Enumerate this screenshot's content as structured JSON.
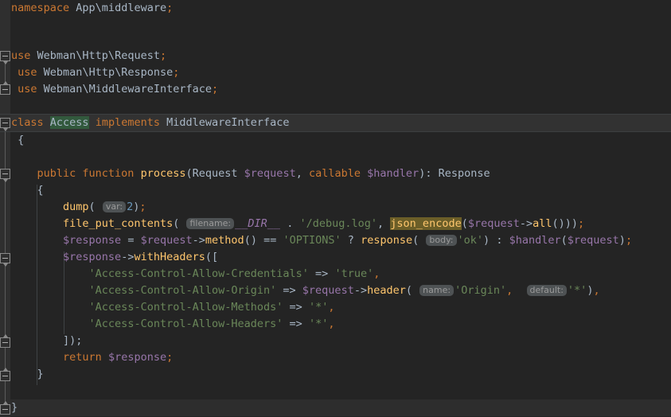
{
  "app": {
    "kind": "code-editor",
    "language": "PHP",
    "theme": "Darcula"
  },
  "colors": {
    "editor_background": "#242424",
    "gutter_background": "#2f2f2f",
    "current_line_highlight": "#323232",
    "keyword": "#cc7832",
    "function": "#ffc66d",
    "variable": "#9876aa",
    "string": "#6a8759",
    "number": "#6897bb",
    "default_text": "#a9b7c6",
    "occurrence_highlight": "#32593d",
    "search_match_highlight": "#6b5e28",
    "inline_hint_background": "#4e5254",
    "inline_hint_text": "#9a9a9a"
  },
  "editor": {
    "lines": [
      {
        "n": 1,
        "indent": 0,
        "text": "namespace App\\middleware;"
      },
      {
        "n": 2,
        "indent": 0,
        "text": ""
      },
      {
        "n": 3,
        "indent": 0,
        "text": ""
      },
      {
        "n": 4,
        "indent": 0,
        "text": ""
      },
      {
        "n": 5,
        "indent": 0,
        "text": "use Webman\\Http\\Request;"
      },
      {
        "n": 6,
        "indent": 0,
        "text": "use Webman\\Http\\Response;"
      },
      {
        "n": 7,
        "indent": 0,
        "text": "use Webman\\MiddlewareInterface;"
      },
      {
        "n": 8,
        "indent": 0,
        "text": ""
      },
      {
        "n": 9,
        "indent": 0,
        "text": ""
      },
      {
        "n": 10,
        "indent": 0,
        "text": "class Access implements MiddlewareInterface"
      },
      {
        "n": 11,
        "indent": 0,
        "text": "{"
      },
      {
        "n": 12,
        "indent": 0,
        "text": ""
      },
      {
        "n": 13,
        "indent": 1,
        "text": "public function process(Request $request, callable $handler): Response"
      },
      {
        "n": 14,
        "indent": 1,
        "text": "{"
      },
      {
        "n": 15,
        "indent": 2,
        "text": "dump( var: 2);"
      },
      {
        "n": 16,
        "indent": 2,
        "text": "file_put_contents( filename: __DIR__ . '/debug.log', json_encode($request->all()));"
      },
      {
        "n": 17,
        "indent": 2,
        "text": "$response = $request->method() == 'OPTIONS' ? response( body: 'ok') : $handler($request);"
      },
      {
        "n": 18,
        "indent": 2,
        "text": "$response->withHeaders(["
      },
      {
        "n": 19,
        "indent": 3,
        "text": "'Access-Control-Allow-Credentials' => 'true',"
      },
      {
        "n": 20,
        "indent": 3,
        "text": "'Access-Control-Allow-Origin' => $request->header( name: 'Origin',  default: '*'),"
      },
      {
        "n": 21,
        "indent": 3,
        "text": "'Access-Control-Allow-Methods' => '*',"
      },
      {
        "n": 22,
        "indent": 3,
        "text": "'Access-Control-Allow-Headers' => '*',"
      },
      {
        "n": 23,
        "indent": 2,
        "text": "]);"
      },
      {
        "n": 24,
        "indent": 2,
        "text": "return $response;"
      },
      {
        "n": 25,
        "indent": 1,
        "text": "}"
      },
      {
        "n": 26,
        "indent": 0,
        "text": ""
      },
      {
        "n": 27,
        "indent": 0,
        "text": "}"
      }
    ],
    "inline_hints": [
      {
        "label": "var:",
        "on_line": 15,
        "for_call": "dump"
      },
      {
        "label": "filename:",
        "on_line": 16,
        "for_call": "file_put_contents"
      },
      {
        "label": "body:",
        "on_line": 17,
        "for_call": "response"
      },
      {
        "label": "name:",
        "on_line": 20,
        "for_call": "header"
      },
      {
        "label": "default:",
        "on_line": 20,
        "for_call": "header"
      }
    ],
    "highlighted_tokens": [
      {
        "token": "Access",
        "on_line": 10,
        "style": "occurrence"
      },
      {
        "token": "json_encode",
        "on_line": 16,
        "style": "search-match"
      }
    ],
    "current_line": 10,
    "fold_markers": [
      {
        "line": 5,
        "type": "collapse-arrow"
      },
      {
        "line": 7,
        "type": "collapse-end"
      },
      {
        "line": 10,
        "type": "collapse-arrow"
      },
      {
        "line": 13,
        "type": "collapse-arrow"
      },
      {
        "line": 16,
        "type": "collapse-arrow"
      },
      {
        "line": 21,
        "type": "collapse-end"
      },
      {
        "line": 23,
        "type": "collapse-end"
      },
      {
        "line": 27,
        "type": "collapse-end"
      }
    ]
  }
}
